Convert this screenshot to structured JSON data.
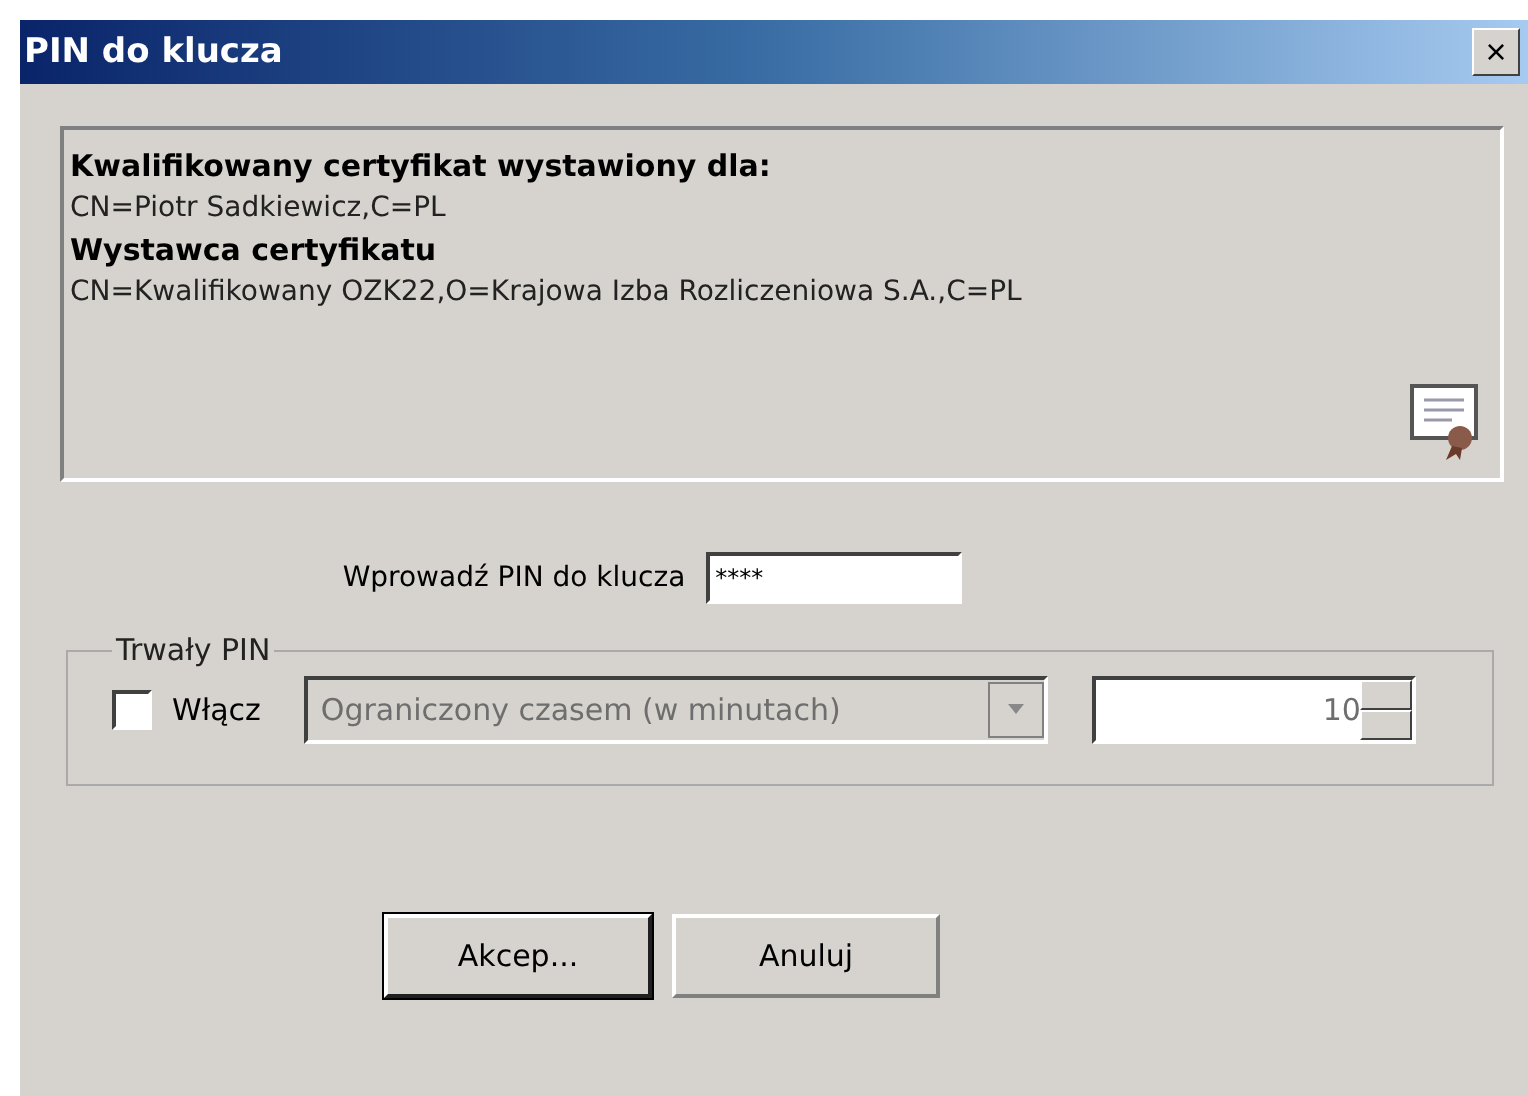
{
  "window": {
    "title": "PIN do klucza",
    "close": "×"
  },
  "certificate": {
    "lines": [
      {
        "text": "Kwalifikowany certyfikat wystawiony dla:",
        "kind": "heading"
      },
      {
        "text": "CN=Piotr Sadkiewicz,C=PL",
        "kind": "value"
      },
      {
        "text": "Wystawca certyfikatu",
        "kind": "heading"
      },
      {
        "text": "CN=Kwalifikowany OZK22,O=Krajowa Izba Rozliczeniowa S.A.,C=PL",
        "kind": "value"
      }
    ]
  },
  "pin": {
    "label": "Wprowadź PIN do klucza",
    "value": "****"
  },
  "persistent_pin": {
    "title": "Trwały PIN",
    "enable": {
      "label": "Włącz",
      "checked": false
    },
    "mode": {
      "value": "Ograniczony czasem (w minutach)",
      "disabled": true
    },
    "minutes": {
      "value": "10",
      "disabled": true
    }
  },
  "buttons": [
    {
      "label": "Akcep...",
      "default": true
    },
    {
      "label": "Anuluj",
      "default": false
    }
  ]
}
